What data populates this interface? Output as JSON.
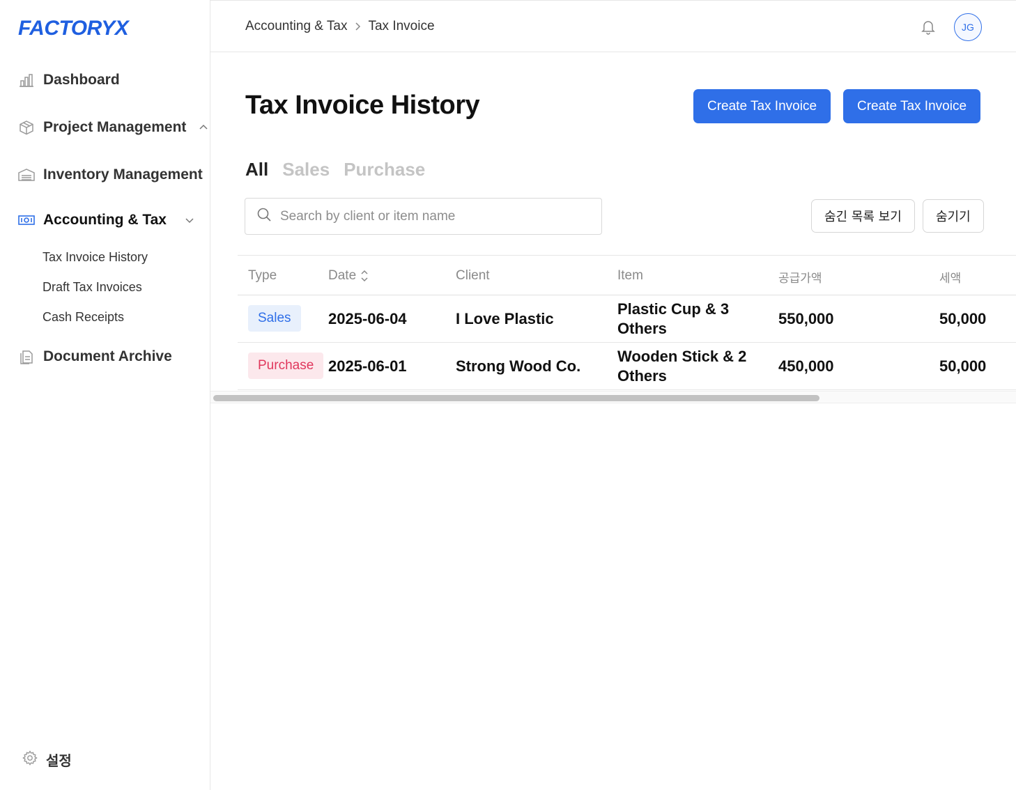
{
  "brand": {
    "logo": "FACTORYX",
    "accent": "#2f6fe8"
  },
  "sidebar": {
    "items": [
      {
        "label": "Dashboard",
        "icon": "bar-chart-icon"
      },
      {
        "label": "Project Management",
        "icon": "box-icon"
      },
      {
        "label": "Inventory Management",
        "icon": "warehouse-icon"
      },
      {
        "label": "Accounting & Tax",
        "icon": "money-icon"
      },
      {
        "label": "Document Archive",
        "icon": "document-icon"
      }
    ],
    "sub_items": [
      "Tax Invoice History",
      "Draft Tax Invoices",
      "Cash Receipts"
    ],
    "settings_label": "설정"
  },
  "header": {
    "breadcrumb": [
      "Accounting & Tax",
      "Tax Invoice"
    ],
    "avatar_initials": "JG"
  },
  "main": {
    "title": "Tax Invoice History",
    "create_button_1": "Create Tax Invoice",
    "create_button_2": "Create Tax Invoice",
    "tabs": [
      "All",
      "Sales",
      "Purchase"
    ],
    "search_placeholder": "Search by client or item name",
    "show_hidden_label": "숨긴 목록 보기",
    "hide_label": "숨기기"
  },
  "table": {
    "headers": [
      "Type",
      "Date",
      "Client",
      "Item",
      "공급가액",
      "세액"
    ],
    "rows": [
      {
        "type": "Sales",
        "date": "2025-06-04",
        "client": "I Love Plastic",
        "item": "Plastic Cup & 3 Others",
        "supply": "550,000",
        "tax": "50,000"
      },
      {
        "type": "Purchase",
        "date": "2025-06-01",
        "client": "Strong Wood Co.",
        "item": "Wooden Stick & 2 Others",
        "supply": "450,000",
        "tax": "50,000"
      }
    ]
  }
}
